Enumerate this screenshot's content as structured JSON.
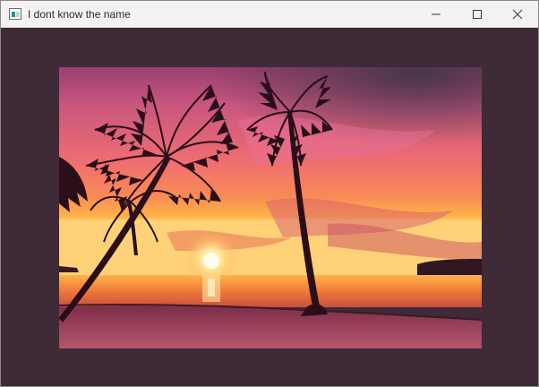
{
  "window": {
    "title": "I dont know the name",
    "background_color": "#3f2b37"
  },
  "titlebar": {
    "icon": "app-window-icon",
    "controls": [
      "minimize-icon",
      "maximize-icon",
      "close-icon"
    ]
  },
  "image": {
    "subject": "tropical beach sunset with palm trees",
    "colors": {
      "sky_top": "#c8567f",
      "sky_mid": "#f07a6a",
      "sky_horizon": "#ffb347",
      "water": "#f0883a",
      "sand": "#a0485c",
      "silhouette": "#2a0f1a"
    }
  }
}
